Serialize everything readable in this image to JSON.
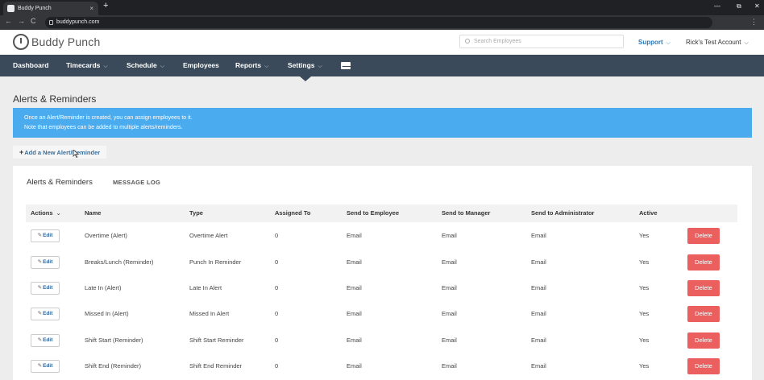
{
  "browser": {
    "tab_title": "Buddy Punch",
    "url": "buddypunch.com",
    "new_tab": "+",
    "tab_close": "×",
    "back": "←",
    "forward": "→",
    "reload": "C",
    "menu": "⋮",
    "minimize": "—",
    "maximize": "⧉",
    "close": "✕"
  },
  "header": {
    "logo_text": "Buddy Punch",
    "search_placeholder": "Search Employees",
    "support_label": "Support",
    "account_label": "Rick's Test Account"
  },
  "nav": {
    "items": [
      {
        "label": "Dashboard",
        "dropdown": false
      },
      {
        "label": "Timecards",
        "dropdown": true
      },
      {
        "label": "Schedule",
        "dropdown": true
      },
      {
        "label": "Employees",
        "dropdown": false
      },
      {
        "label": "Reports",
        "dropdown": true
      },
      {
        "label": "Settings",
        "dropdown": true
      }
    ],
    "caret": "⌵",
    "mail_icon": "envelope-icon"
  },
  "page": {
    "title": "Alerts & Reminders",
    "info_line1": "Once an Alert/Reminder is created, you can assign employees to it.",
    "info_line2": "Note that employees can be added to multiple alerts/reminders.",
    "add_button": "Add a New Alert/Reminder",
    "add_plus": "+"
  },
  "card": {
    "tab_active": "Alerts & Reminders",
    "tab_other": "MESSAGE LOG"
  },
  "table": {
    "columns": [
      "Actions",
      "Name",
      "Type",
      "Assigned To",
      "Send to Employee",
      "Send to Manager",
      "Send to Administrator",
      "Active"
    ],
    "actions_caret": "⌄",
    "edit_label": "Edit",
    "edit_pen": "✎",
    "delete_label": "Delete",
    "rows": [
      {
        "name": "Overtime (Alert)",
        "type": "Overtime Alert",
        "assigned": "0",
        "employee": "Email",
        "manager": "Email",
        "admin": "Email",
        "active": "Yes"
      },
      {
        "name": "Breaks/Lunch (Reminder)",
        "type": "Punch In Reminder",
        "assigned": "0",
        "employee": "Email",
        "manager": "Email",
        "admin": "Email",
        "active": "Yes"
      },
      {
        "name": "Late In (Alert)",
        "type": "Late In Alert",
        "assigned": "0",
        "employee": "Email",
        "manager": "Email",
        "admin": "Email",
        "active": "Yes"
      },
      {
        "name": "Missed In (Alert)",
        "type": "Missed In Alert",
        "assigned": "0",
        "employee": "Email",
        "manager": "Email",
        "admin": "Email",
        "active": "Yes"
      },
      {
        "name": "Shift Start (Reminder)",
        "type": "Shift Start Reminder",
        "assigned": "0",
        "employee": "Email",
        "manager": "Email",
        "admin": "Email",
        "active": "Yes"
      },
      {
        "name": "Shift End (Reminder)",
        "type": "Shift End Reminder",
        "assigned": "0",
        "employee": "Email",
        "manager": "Email",
        "admin": "Email",
        "active": "Yes"
      }
    ]
  },
  "colors": {
    "nav_bg": "#3a4a5a",
    "info_bg": "#4aabef",
    "delete_bg": "#ec5f5f",
    "link": "#2a7ab9"
  }
}
